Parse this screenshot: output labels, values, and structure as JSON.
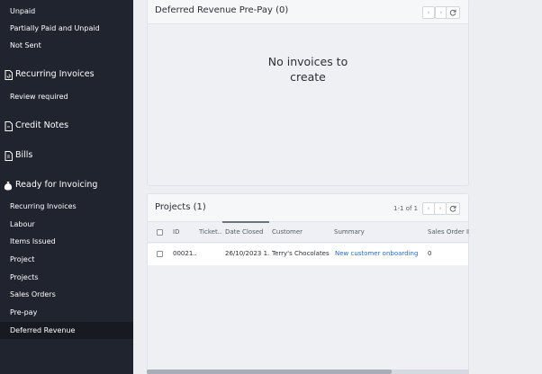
{
  "sidebar": {
    "invoice_filters": [
      "Unpaid",
      "Partially Paid and Unpaid",
      "Not Sent"
    ],
    "recurring_section": "Recurring Invoices",
    "recurring_items": [
      "Review required"
    ],
    "credit_notes": "Credit Notes",
    "bills": "Bills",
    "ready_section": "Ready for Invoicing",
    "ready_items": [
      "Recurring Invoices",
      "Labour",
      "Items Issued",
      "Project",
      "Projects",
      "Sales Orders",
      "Pre-pay",
      "Deferred Revenue"
    ],
    "active_item": "Deferred Revenue"
  },
  "deferred_panel": {
    "title": "Deferred Revenue Pre-Pay (0)",
    "empty_line1": "No invoices to",
    "empty_line2": "create",
    "prev_icon": "chevron-left-icon",
    "next_icon": "chevron-right-icon",
    "refresh_icon": "refresh-icon"
  },
  "projects_panel": {
    "title": "Projects (1)",
    "pager": "1-1 of 1",
    "columns": [
      "ID",
      "Ticket...",
      "Date Closed",
      "Customer",
      "Summary",
      "Sales Order ID"
    ],
    "rows": [
      {
        "id": "00021...",
        "ticket": "",
        "date_closed": "26/10/2023 1...",
        "customer": "Terry's Chocolates",
        "summary": "New customer onboarding",
        "sales_order_id": "0"
      }
    ]
  },
  "colors": {
    "sidebar_bg": "#20242e",
    "sidebar_active": "#171a21",
    "link": "#2e6ab8"
  }
}
